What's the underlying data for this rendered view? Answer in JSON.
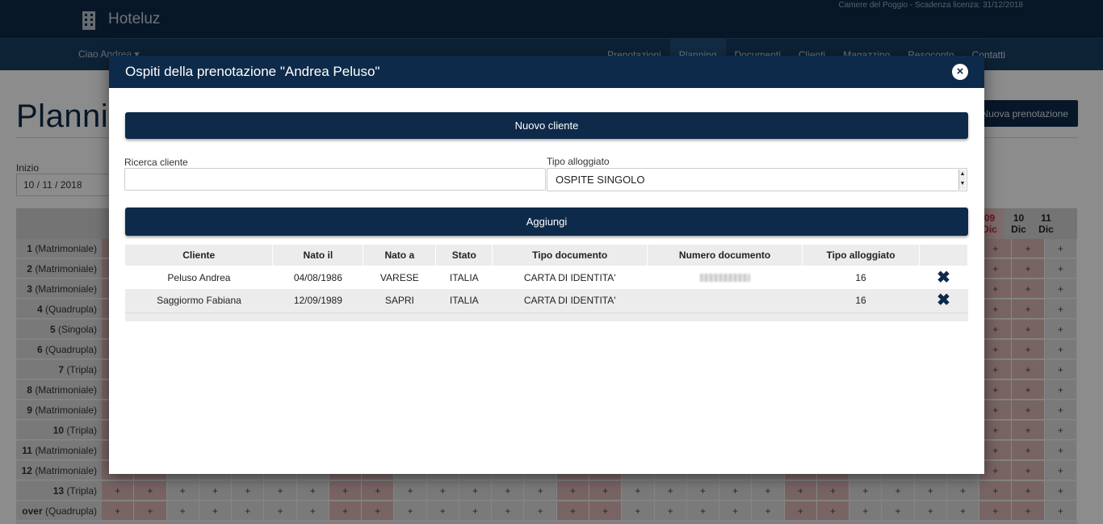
{
  "app": {
    "brand": "Hoteluz",
    "license": "Camere del Poggio - Scadenza licenza: 31/12/2018",
    "greeting": "Ciao Andrea ▾",
    "menu": [
      "Prenotazioni",
      "Planning",
      "Documenti",
      "Clienti",
      "Magazzino",
      "Resoconto",
      "Contatti"
    ],
    "active_menu": "Planning"
  },
  "page": {
    "title": "Planning",
    "new_booking_label": "Nuova prenotazione",
    "start_label": "Inizio",
    "start_value": "10 / 11 / 2018"
  },
  "planning": {
    "days": [
      {
        "num": "09",
        "month": "Dic",
        "weekend": true
      },
      {
        "num": "10",
        "month": "Dic",
        "weekend": false
      },
      {
        "num": "11",
        "month": "Dic",
        "weekend": false
      }
    ],
    "rooms": [
      {
        "num": "1",
        "type": "(Matrimoniale)"
      },
      {
        "num": "2",
        "type": "(Matrimoniale)"
      },
      {
        "num": "3",
        "type": "(Matrimoniale)"
      },
      {
        "num": "4",
        "type": "(Quadrupla)"
      },
      {
        "num": "5",
        "type": "(Singola)"
      },
      {
        "num": "6",
        "type": "(Quadrupla)"
      },
      {
        "num": "7",
        "type": "(Tripla)"
      },
      {
        "num": "8",
        "type": "(Matrimoniale)"
      },
      {
        "num": "9",
        "type": "(Matrimoniale)"
      },
      {
        "num": "10",
        "type": "(Tripla)"
      },
      {
        "num": "11",
        "type": "(Matrimoniale)"
      },
      {
        "num": "12",
        "type": "(Matrimoniale)"
      },
      {
        "num": "13",
        "type": "(Tripla)"
      },
      {
        "num": "over",
        "type": "(Quadrupla)"
      }
    ],
    "cell_symbol": "+"
  },
  "modal": {
    "title": "Ospiti della prenotazione \"Andrea Peluso\"",
    "close_icon": "×",
    "new_client_label": "Nuovo cliente",
    "search_label": "Ricerca cliente",
    "search_value": "",
    "guest_type_label": "Tipo alloggiato",
    "guest_type_value": "OSPITE SINGOLO",
    "add_label": "Aggiungi",
    "columns": [
      "Cliente",
      "Nato il",
      "Nato a",
      "Stato",
      "Tipo documento",
      "Numero documento",
      "Tipo alloggiato",
      ""
    ],
    "rows": [
      {
        "cliente": "Peluso Andrea",
        "nato_il": "04/08/1986",
        "nato_a": "VARESE",
        "stato": "ITALIA",
        "tipo_documento": "CARTA DI IDENTITA'",
        "numero_documento": "",
        "tipo_alloggiato": "16"
      },
      {
        "cliente": "Saggiormo Fabiana",
        "nato_il": "12/09/1989",
        "nato_a": "SAPRI",
        "stato": "ITALIA",
        "tipo_documento": "CARTA DI IDENTITA'",
        "numero_documento": "",
        "tipo_alloggiato": "16"
      }
    ],
    "delete_icon": "✖"
  },
  "colors": {
    "navy": "#0d2a4a",
    "weekend_red": "#c0272d"
  }
}
